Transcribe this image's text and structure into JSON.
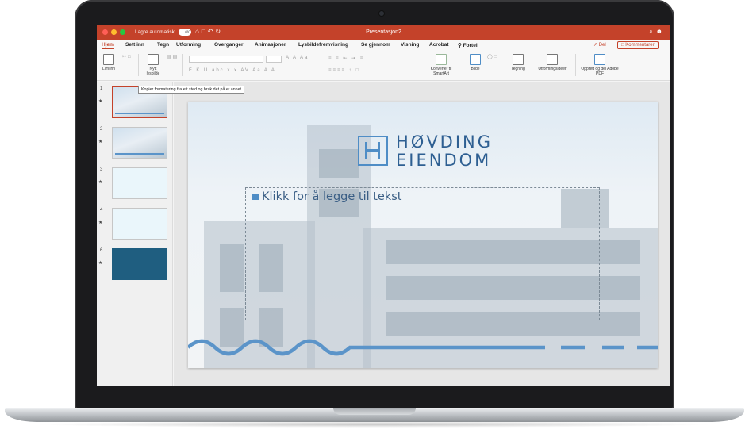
{
  "window": {
    "autosave_label": "Lagre automatisk",
    "autosave_state": "AV",
    "document_title": "Presentasjon2"
  },
  "tabs": [
    {
      "label": "Hjem"
    },
    {
      "label": "Sett inn"
    },
    {
      "label": "Tegn"
    },
    {
      "label": "Utforming"
    },
    {
      "label": "Overganger"
    },
    {
      "label": "Animasjoner"
    },
    {
      "label": "Lysbildefremvisning"
    },
    {
      "label": "Se gjennom"
    },
    {
      "label": "Visning"
    },
    {
      "label": "Acrobat"
    },
    {
      "label": "Fortell"
    }
  ],
  "actions": {
    "share_label": "Del",
    "comments_label": "Kommentarer"
  },
  "ribbon": {
    "paste_label": "Lim inn",
    "new_slide_label": "Nytt lysbilde",
    "convert_smartart_label": "Konverter til SmartArt",
    "picture_label": "Bilde",
    "drawing_label": "Tegning",
    "design_ideas_label": "Utformingsideer",
    "create_pdf_label": "Opprett og del Adobe PDF"
  },
  "tooltip": "Kopier formatering fra ett sted og bruk det på et annet",
  "slides": [
    {
      "number": "1"
    },
    {
      "number": "2"
    },
    {
      "number": "3"
    },
    {
      "number": "4"
    },
    {
      "number": "6"
    }
  ],
  "slide": {
    "logo_line1": "HØVDING",
    "logo_line2": "EIENDOM",
    "placeholder_text": "Klikk for å legge til tekst"
  },
  "colors": {
    "accent": "#c4422a",
    "brand_blue": "#4f8dc6",
    "logo_text": "#2e5f92",
    "dark_slide": "#1f5e80"
  }
}
